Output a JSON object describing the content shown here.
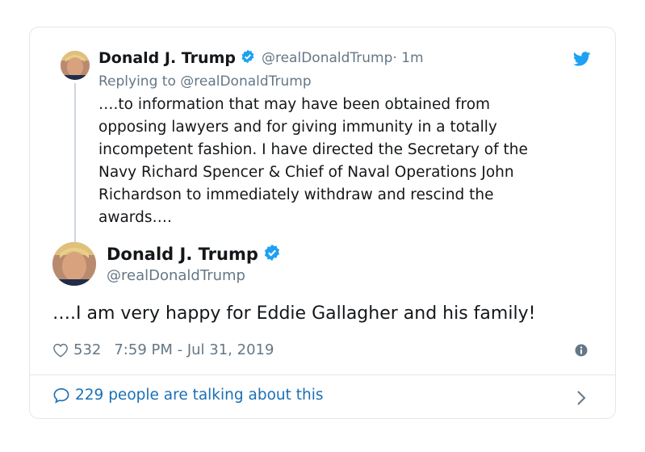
{
  "parent": {
    "name": "Donald J. Trump",
    "handle": "@realDonaldTrump",
    "time": " · 1m",
    "replying": "Replying to @realDonaldTrump",
    "text": "….to information that may have been obtained from\nopposing lawyers and for giving immunity in a totally\nincompetent fashion. I have directed the Secretary of the\nNavy Richard Spencer & Chief of Naval Operations John\nRichardson to immediately withdraw and rescind the\nawards…."
  },
  "tweet": {
    "name": "Donald J. Trump",
    "handle": "@realDonaldTrump",
    "text": "….I am very happy for Eddie Gallagher and his family!",
    "likes": "532",
    "timestamp": "7:59 PM - Jul 31, 2019"
  },
  "footer": {
    "talking": "229 people are talking about this"
  },
  "colors": {
    "accent": "#1da1f2",
    "link": "#1b6fb5",
    "muted": "#657786",
    "border": "#e1e8ed"
  },
  "icons": {
    "verified": "verified-badge-icon",
    "brand": "twitter-bird-icon",
    "like": "heart-icon",
    "info": "info-icon",
    "reply": "speech-bubble-icon",
    "more": "chevron-right-icon"
  }
}
